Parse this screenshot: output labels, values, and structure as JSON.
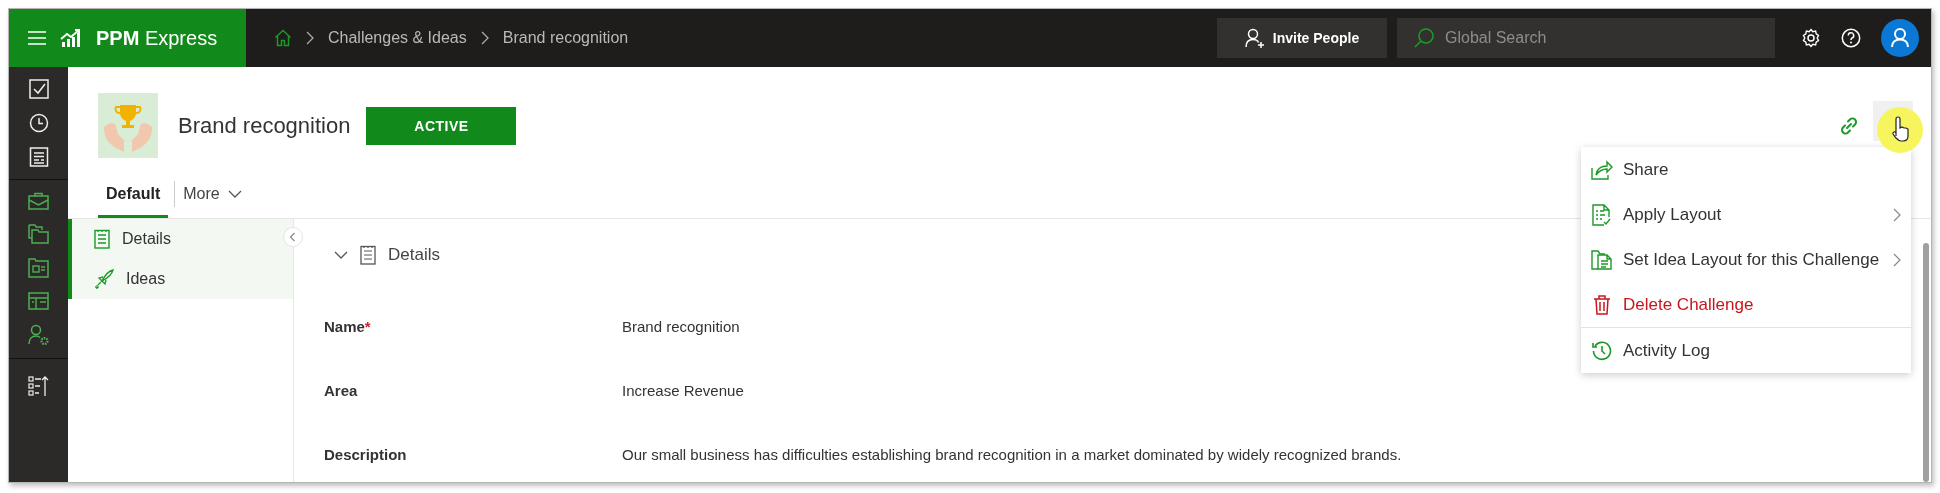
{
  "app": {
    "name_bold": "PPM",
    "name_rest": "Express"
  },
  "breadcrumb": [
    "Challenges & Ideas",
    "Brand recognition"
  ],
  "invite_button": "Invite People",
  "search": {
    "placeholder": "Global Search"
  },
  "header": {
    "title": "Brand recognition",
    "status": "ACTIVE"
  },
  "tabs": [
    {
      "label": "Default",
      "selected": true,
      "kind": "tab"
    },
    {
      "label": "More",
      "selected": false,
      "kind": "dropdown"
    }
  ],
  "nav": [
    {
      "label": "Details"
    },
    {
      "label": "Ideas"
    }
  ],
  "section": {
    "title": "Details",
    "expanded": true
  },
  "fields": [
    {
      "label": "Name",
      "required_mark": "*",
      "value": "Brand recognition"
    },
    {
      "label": "Area",
      "value": "Increase Revenue"
    },
    {
      "label": "Description",
      "value": "Our small business has difficulties establishing brand recognition in a market dominated by widely recognized brands."
    }
  ],
  "menu": [
    {
      "label": "Share",
      "kind": "action"
    },
    {
      "label": "Apply Layout",
      "kind": "submenu"
    },
    {
      "label": "Set Idea Layout for this Challenge",
      "kind": "submenu"
    },
    {
      "label": "Delete Challenge",
      "kind": "danger"
    },
    {
      "label": "Activity Log",
      "kind": "action",
      "divider_before": true
    }
  ]
}
